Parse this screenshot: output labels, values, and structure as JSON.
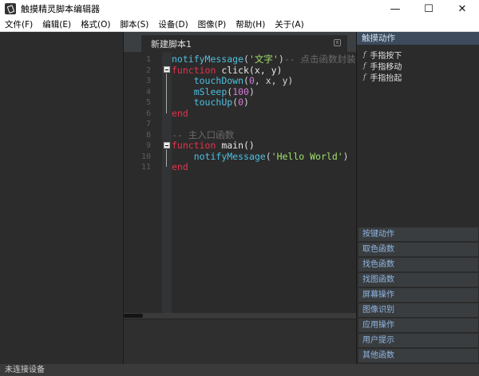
{
  "window": {
    "title": "触摸精灵脚本编辑器",
    "minimize": "—",
    "maximize": "☐",
    "close": "✕"
  },
  "menu": [
    "文件(F)",
    "编辑(E)",
    "格式(O)",
    "脚本(S)",
    "设备(D)",
    "图像(P)",
    "帮助(H)",
    "关于(A)"
  ],
  "editor": {
    "tab_title": "新建脚本1",
    "tab_close": "x",
    "line_numbers": [
      "1",
      "2",
      "3",
      "4",
      "5",
      "6",
      "7",
      "8",
      "9",
      "10",
      "11"
    ]
  },
  "right_panel": {
    "header": "触摸动作",
    "items": [
      "手指按下",
      "手指移动",
      "手指抬起"
    ],
    "fx_symbol": "f",
    "categories": [
      "按键动作",
      "取色函数",
      "找色函数",
      "找图函数",
      "屏幕操作",
      "图像识别",
      "应用操作",
      "用户提示",
      "其他函数"
    ]
  },
  "status": {
    "text": "未连接设备"
  },
  "colors": {
    "keyword": "#e5334d",
    "string": "#a0e06b",
    "number": "#d37bd9",
    "comment": "#6a6a6a",
    "call": "#4ec0e0",
    "panel_header": "#3d4b5c",
    "category_text": "#8fb6e3"
  }
}
